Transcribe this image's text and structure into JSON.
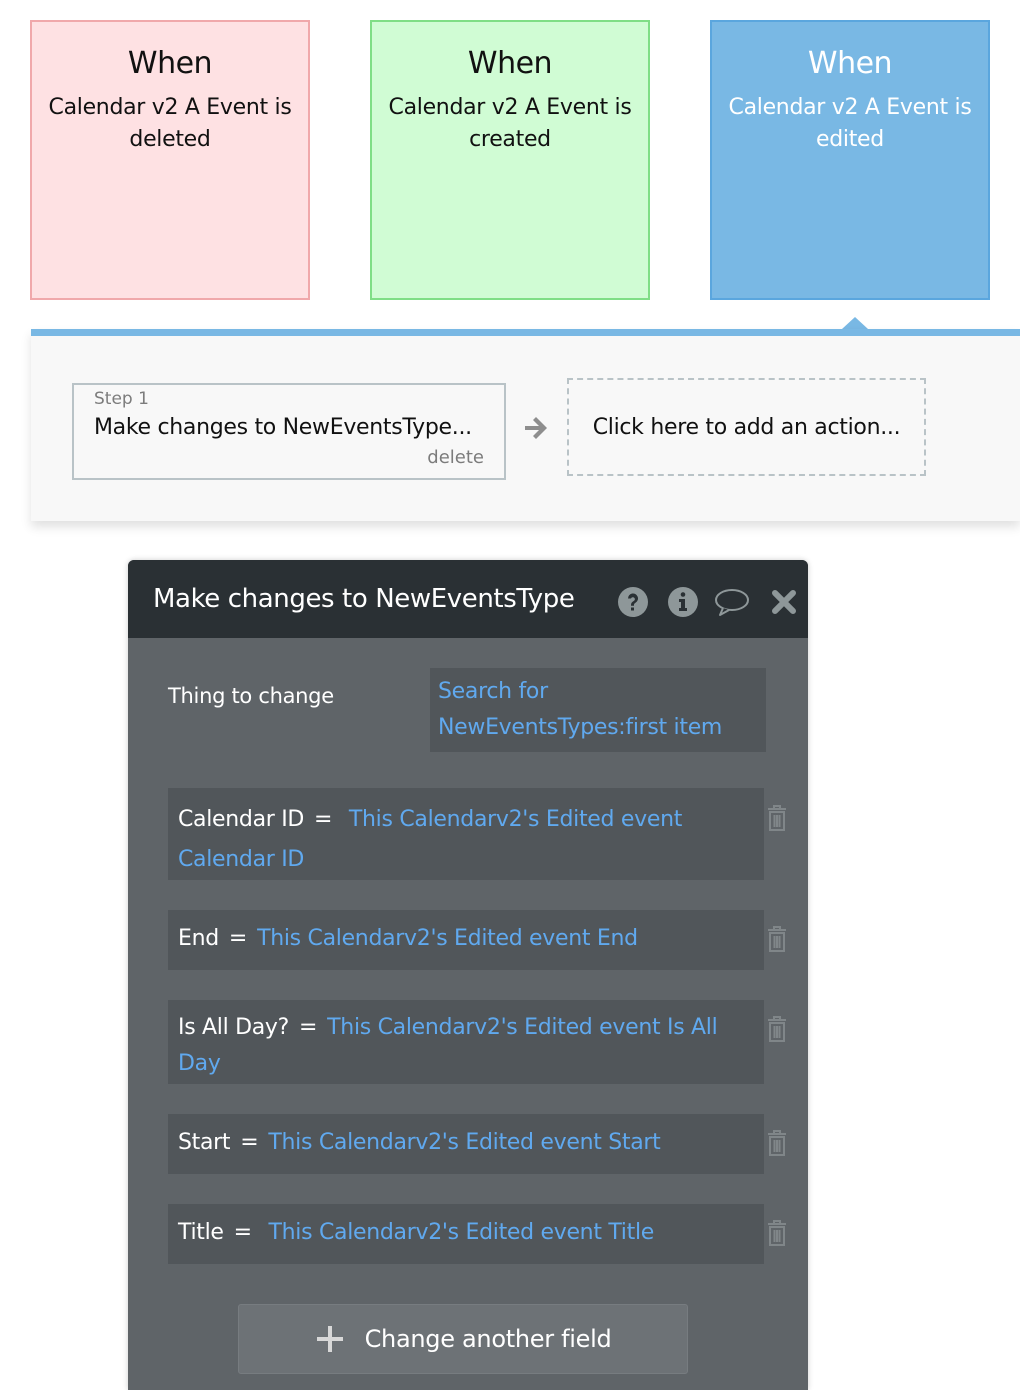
{
  "event_cards": [
    {
      "when": "When",
      "description": "Calendar v2 A Event is deleted",
      "color": "#fee1e3"
    },
    {
      "when": "When",
      "description": "Calendar v2 A Event is created",
      "color": "#d0fcd4"
    },
    {
      "when": "When",
      "description": "Calendar v2 A Event is edited",
      "color": "#79b8e4",
      "selected": true
    }
  ],
  "workflow": {
    "steps": [
      {
        "label": "Step 1",
        "title": "Make changes to NewEventsType...",
        "delete_label": "delete"
      }
    ],
    "add_action_label": "Click here to add an action..."
  },
  "editor": {
    "title": "Make changes to NewEventsType",
    "header_icons": [
      "help-icon",
      "info-icon",
      "comment-icon",
      "close-icon"
    ],
    "thing_to_change": {
      "label": "Thing to change",
      "value": "Search for NewEventsTypes:first item"
    },
    "fields": [
      {
        "name": "Calendar ID",
        "operator": "=",
        "value": "This Calendarv2's Edited event Calendar ID"
      },
      {
        "name": "End",
        "operator": "=",
        "value": "This Calendarv2's Edited event End"
      },
      {
        "name": "Is All Day?",
        "operator": "=",
        "value": "This Calendarv2's Edited event Is All Day"
      },
      {
        "name": "Start",
        "operator": "=",
        "value": "This Calendarv2's Edited event Start"
      },
      {
        "name": "Title",
        "operator": "=",
        "value": "This Calendarv2's Edited event Title"
      }
    ],
    "add_field_label": "Change another field"
  },
  "colors": {
    "accent": "#79b8e4",
    "link": "#60a9ef",
    "editor_header": "#2a3034",
    "editor_body": "#5f6468"
  }
}
